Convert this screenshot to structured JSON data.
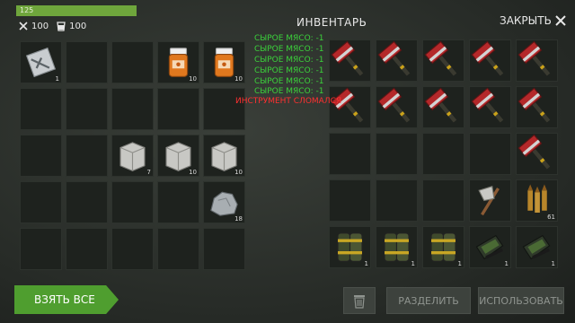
{
  "hud": {
    "health": "125",
    "health_fraction": 1.0,
    "hunger": "100",
    "thirst": "100"
  },
  "inventory": {
    "title": "ИНВЕНТАРЬ",
    "close_label": "ЗАКРЫТЬ"
  },
  "log": {
    "green_lines": [
      "СЫРОЕ МЯСО: -1",
      "СЫРОЕ МЯСО: -1",
      "СЫРОЕ МЯСО: -1"
    ],
    "red_line": "ИНСТРУМЕНТ СЛОМАЛСЯ"
  },
  "left_grid": {
    "cells": [
      {
        "icon": "blueprint-note",
        "count": "1"
      },
      null,
      null,
      {
        "icon": "pill-bottle",
        "count": "10"
      },
      {
        "icon": "pill-bottle",
        "count": "10"
      },
      null,
      null,
      null,
      null,
      null,
      null,
      null,
      {
        "icon": "stone-block",
        "count": "7"
      },
      {
        "icon": "stone-block",
        "count": "10"
      },
      {
        "icon": "stone-block",
        "count": "10"
      },
      null,
      null,
      null,
      null,
      {
        "icon": "ore-rock",
        "count": "18"
      },
      null,
      null,
      null,
      null,
      null
    ]
  },
  "right_grid": {
    "cells": [
      {
        "icon": "red-hammer",
        "count": ""
      },
      {
        "icon": "red-hammer",
        "count": ""
      },
      {
        "icon": "red-hammer",
        "count": ""
      },
      {
        "icon": "red-hammer",
        "count": ""
      },
      {
        "icon": "red-hammer",
        "count": ""
      },
      {
        "icon": "red-hammer",
        "count": ""
      },
      {
        "icon": "red-hammer",
        "count": ""
      },
      {
        "icon": "red-hammer",
        "count": ""
      },
      {
        "icon": "red-hammer",
        "count": ""
      },
      {
        "icon": "red-hammer",
        "count": ""
      },
      null,
      null,
      null,
      null,
      {
        "icon": "red-hammer",
        "count": ""
      },
      null,
      null,
      null,
      {
        "icon": "stone-axe",
        "count": ""
      },
      {
        "icon": "bullets",
        "count": "61"
      },
      {
        "icon": "armor-pad",
        "count": "1"
      },
      {
        "icon": "armor-pad",
        "count": "1"
      },
      {
        "icon": "armor-pad",
        "count": "1"
      },
      {
        "icon": "armor-boot",
        "count": "1"
      },
      {
        "icon": "armor-boot",
        "count": "1"
      }
    ]
  },
  "buttons": {
    "take_all": "ВЗЯТЬ ВСЕ",
    "split": "РАЗДЕЛИТЬ",
    "use": "ИСПОЛЬЗОВАТЬ"
  },
  "colors": {
    "accent_green": "#4f9e2f",
    "log_green": "#3bd13b",
    "log_red": "#ff3030"
  }
}
